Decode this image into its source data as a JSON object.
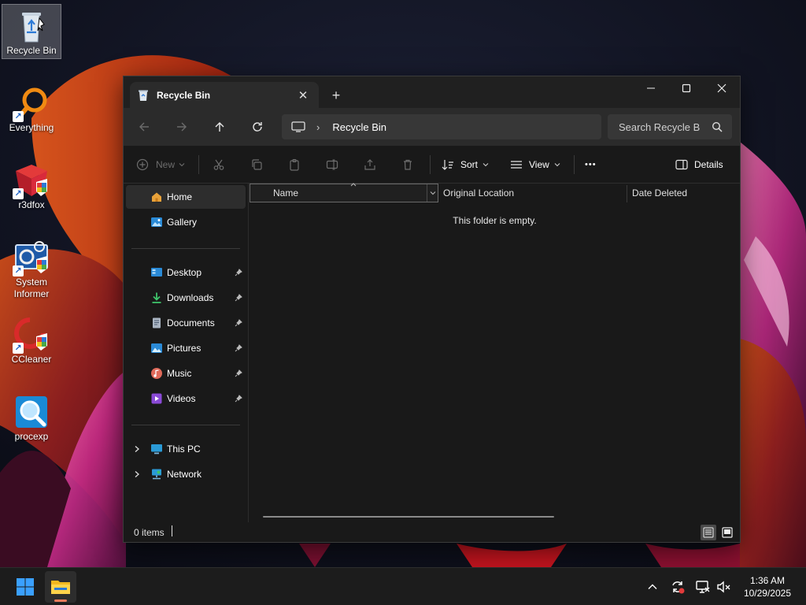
{
  "desktop": {
    "icons": [
      {
        "label": "Recycle Bin",
        "icon": "recycle-bin-icon",
        "selected": true
      },
      {
        "label": "Everything",
        "icon": "everything-search-icon",
        "shortcut": true
      },
      {
        "label": "r3dfox",
        "icon": "r3dfox-icon",
        "shortcut": true
      },
      {
        "label": "System Informer",
        "icon": "system-informer-icon",
        "shortcut": true
      },
      {
        "label": "CCleaner",
        "icon": "ccleaner-icon",
        "shortcut": true
      },
      {
        "label": "procexp",
        "icon": "procexp-icon"
      }
    ]
  },
  "window": {
    "tab_title": "Recycle Bin",
    "tab_close": "✕",
    "new_tab": "+",
    "controls": {
      "minimize": "—",
      "maximize": "☐",
      "close": "✕"
    },
    "nav": {
      "back": "back-arrow-icon",
      "forward": "forward-arrow-icon",
      "up": "up-arrow-icon",
      "refresh": "refresh-icon"
    },
    "address": {
      "separator": "›",
      "crumb": "Recycle Bin"
    },
    "search": {
      "placeholder": "Search Recycle Bin"
    },
    "toolbar": {
      "new_label": "New",
      "sort_label": "Sort",
      "view_label": "View",
      "more_label": "•••",
      "details_label": "Details"
    },
    "sidebar": {
      "top": [
        {
          "label": "Home",
          "icon": "home-icon",
          "active": true
        },
        {
          "label": "Gallery",
          "icon": "gallery-icon"
        }
      ],
      "pinned": [
        {
          "label": "Desktop",
          "icon": "desktop-folder-icon"
        },
        {
          "label": "Downloads",
          "icon": "downloads-icon"
        },
        {
          "label": "Documents",
          "icon": "documents-icon"
        },
        {
          "label": "Pictures",
          "icon": "pictures-icon"
        },
        {
          "label": "Music",
          "icon": "music-icon"
        },
        {
          "label": "Videos",
          "icon": "videos-icon"
        }
      ],
      "tree": [
        {
          "label": "This PC",
          "icon": "this-pc-icon"
        },
        {
          "label": "Network",
          "icon": "network-icon"
        }
      ]
    },
    "columns": {
      "name": "Name",
      "original_location": "Original Location",
      "date_deleted": "Date Deleted"
    },
    "empty_message": "This folder is empty.",
    "status": {
      "count": "0 items"
    }
  },
  "taskbar": {
    "clock": {
      "time": "1:36 AM",
      "date": "10/29/2025"
    }
  },
  "colors": {
    "window_bg": "#191919",
    "navbar_bg": "#2b2b2b",
    "taskbar_bg": "#1c1c1c",
    "accent_indicator": "#eb7a5b"
  }
}
